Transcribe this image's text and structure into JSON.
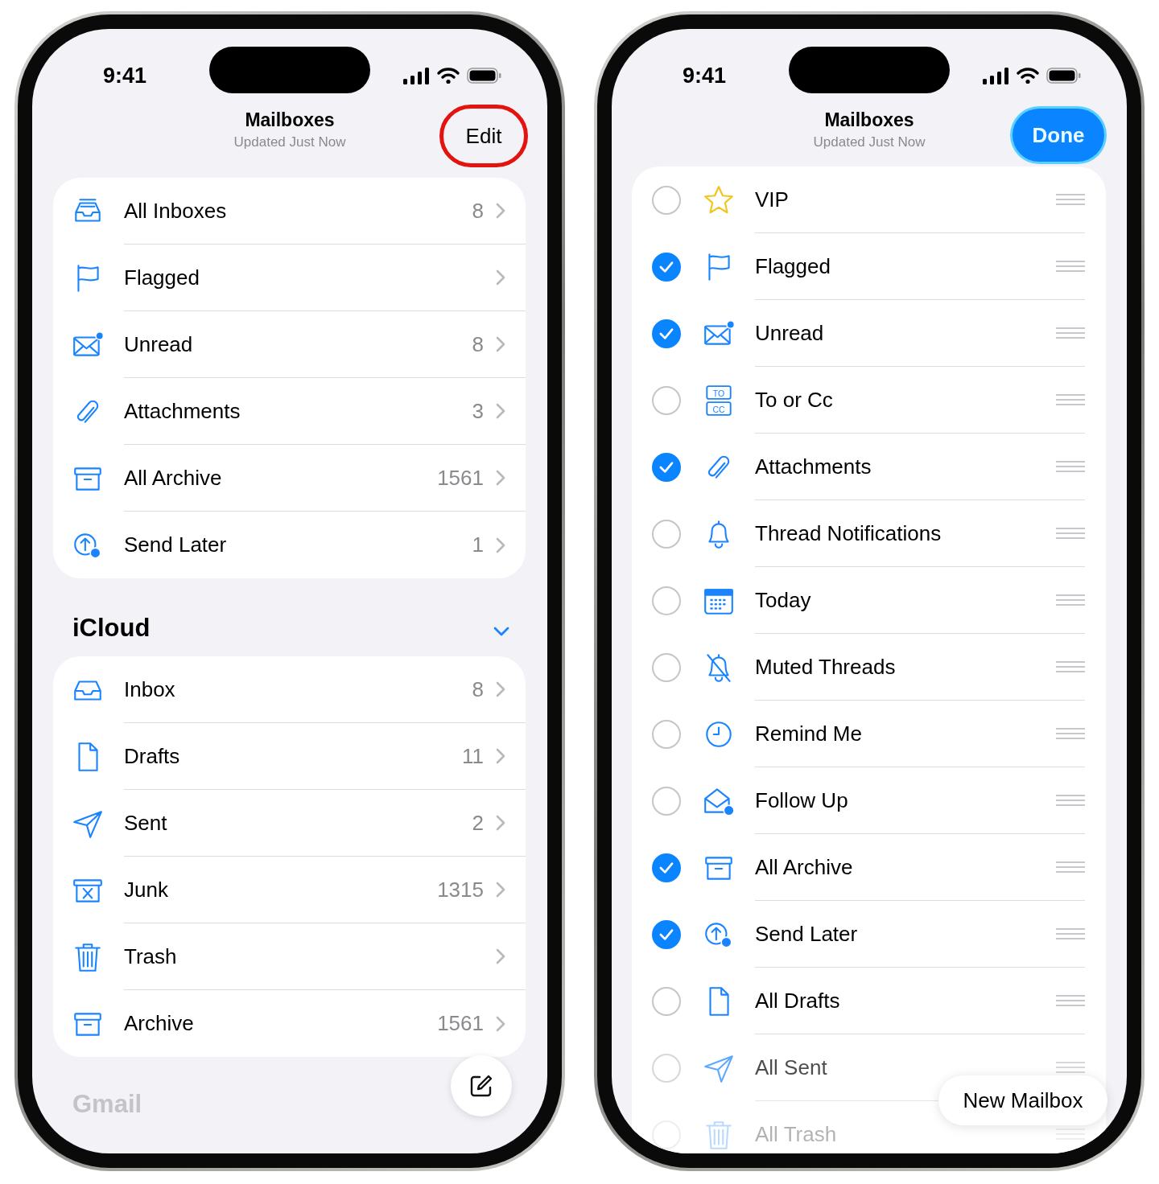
{
  "mailboxes_screen": {
    "status_time": "9:41",
    "title": "Mailboxes",
    "subtitle": "Updated Just Now",
    "edit_button": {
      "label": "Edit",
      "highlighted": true
    },
    "favorites": [
      {
        "kind": "inboxes",
        "label": "All Inboxes",
        "count": "8"
      },
      {
        "kind": "flag",
        "label": "Flagged"
      },
      {
        "kind": "unread",
        "label": "Unread",
        "count": "8"
      },
      {
        "kind": "attachment",
        "label": "Attachments",
        "count": "3"
      },
      {
        "kind": "archive",
        "label": "All Archive",
        "count": "1561"
      },
      {
        "kind": "send-later",
        "label": "Send Later",
        "count": "1"
      }
    ],
    "sections": [
      {
        "title": "iCloud",
        "expanded": true,
        "rows": [
          {
            "kind": "inbox",
            "label": "Inbox",
            "count": "8"
          },
          {
            "kind": "document",
            "label": "Drafts",
            "count": "11"
          },
          {
            "kind": "sent",
            "label": "Sent",
            "count": "2"
          },
          {
            "kind": "junk",
            "label": "Junk",
            "count": "1315"
          },
          {
            "kind": "trash",
            "label": "Trash"
          },
          {
            "kind": "archive",
            "label": "Archive",
            "count": "1561"
          }
        ]
      }
    ],
    "next_section": "Gmail"
  },
  "edit_screen": {
    "status_time": "9:41",
    "title": "Mailboxes",
    "subtitle": "Updated Just Now",
    "done_button": {
      "label": "Done"
    },
    "rows": [
      {
        "kind": "vip",
        "label": "VIP",
        "checked": false
      },
      {
        "kind": "flag",
        "label": "Flagged",
        "checked": true
      },
      {
        "kind": "unread",
        "label": "Unread",
        "checked": true
      },
      {
        "kind": "to-cc",
        "label": "To or Cc",
        "checked": false,
        "icon_text": [
          "TO",
          "CC"
        ]
      },
      {
        "kind": "attachment",
        "label": "Attachments",
        "checked": true
      },
      {
        "kind": "bell",
        "label": "Thread Notifications",
        "checked": false
      },
      {
        "kind": "calendar",
        "label": "Today",
        "checked": false
      },
      {
        "kind": "bell-slash",
        "label": "Muted Threads",
        "checked": false
      },
      {
        "kind": "clock",
        "label": "Remind Me",
        "checked": false
      },
      {
        "kind": "follow-up",
        "label": "Follow Up",
        "checked": false
      },
      {
        "kind": "archive",
        "label": "All Archive",
        "checked": true
      },
      {
        "kind": "send-later",
        "label": "Send Later",
        "checked": true
      },
      {
        "kind": "document",
        "label": "All Drafts",
        "checked": false
      },
      {
        "kind": "sent",
        "label": "All Sent",
        "checked": false
      },
      {
        "kind": "trash",
        "label": "All Trash",
        "checked": false
      }
    ],
    "new_mailbox_button": "New Mailbox"
  }
}
